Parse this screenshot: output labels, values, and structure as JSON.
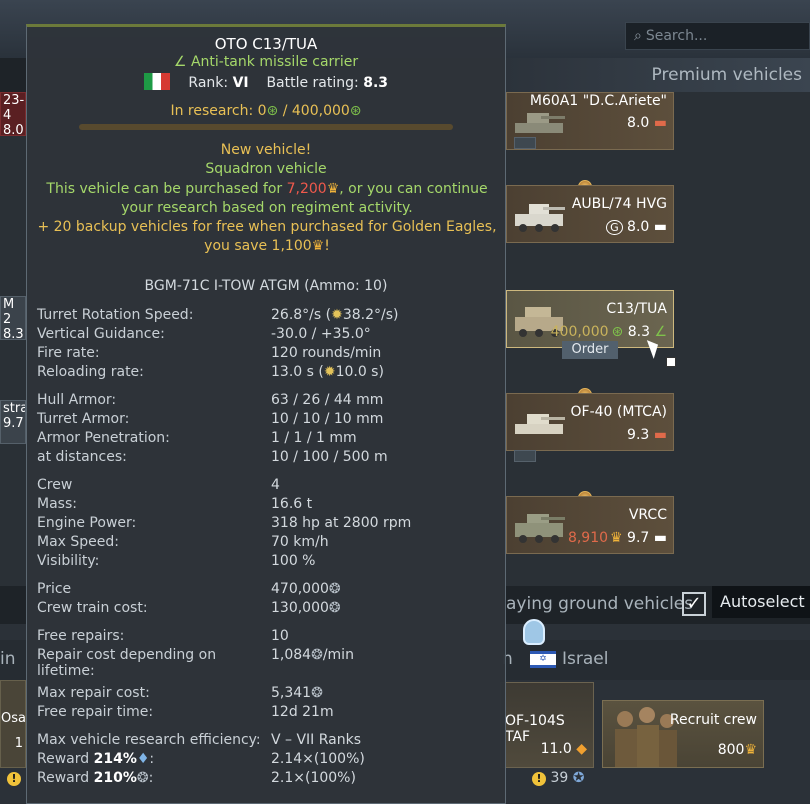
{
  "search": {
    "placeholder": "Search..."
  },
  "tree_header": "Premium vehicles",
  "left_cards": [
    {
      "text": "23-4",
      "sub": "8.0"
    },
    {
      "text": "M 2",
      "sub": "8.3"
    },
    {
      "text": "stra",
      "sub": "9.7"
    }
  ],
  "vehicles": [
    {
      "name": "M60A1 \"D.C.Ariete\"",
      "br": "8.0",
      "icon": "tank-icon"
    },
    {
      "name": "AUBL/74 HVG",
      "br": "8.0",
      "icon": "tank-icon",
      "prefix": "G"
    },
    {
      "name": "C13/TUA",
      "br": "8.3",
      "research": "400,000",
      "icon": "tank-icon"
    },
    {
      "name": "OF-40 (MTCA)",
      "br": "9.3",
      "icon": "tank-icon"
    },
    {
      "name": "VRCC",
      "br": "9.7",
      "price": "8,910",
      "icon": "tank-icon"
    }
  ],
  "order_label": "Order",
  "ground_label": "aying ground vehicles",
  "autoselect_label": "Autoselect",
  "nation_tabs": {
    "left": "in",
    "mid": "n",
    "israel": "Israel"
  },
  "crew_slot": {
    "name": "OF-104S TAF",
    "br": "11.0",
    "left_name": "Osa-",
    "left_br": "1"
  },
  "recruit": {
    "label": "Recruit crew",
    "price": "800"
  },
  "crew_count": "39",
  "tooltip": {
    "title": "OTO C13/TUA",
    "subtitle": "Anti-tank missile carrier",
    "rank_label": "Rank:",
    "rank_value": "VI",
    "br_label": "Battle rating:",
    "br_value": "8.3",
    "research_label": "In research: 0",
    "research_total": " / 400,000",
    "research_progress": 0,
    "new_vehicle": "New vehicle!",
    "squadron": "Squadron vehicle",
    "desc_a": "This vehicle can be purchased for ",
    "desc_price": "7,200",
    "desc_b": ", or you can continue your research based on regiment activity.",
    "backup_a": "+ 20 backup vehicles for free when purchased for Golden Eagles, you save 1,100",
    "backup_b": "!",
    "weapon": "BGM-71C I-TOW ATGM (Ammo: 10)",
    "stats": {
      "turret_rot": {
        "k": "Turret Rotation Speed:",
        "v": "26.8°/s (",
        "v2": "38.2°/s)"
      },
      "vertical": {
        "k": "Vertical Guidance:",
        "v": "-30.0 / +35.0°"
      },
      "fire_rate": {
        "k": "Fire rate:",
        "v": "120 rounds/min"
      },
      "reload": {
        "k": "Reloading rate:",
        "v": "13.0 s (",
        "v2": "10.0 s)"
      },
      "hull": {
        "k": "Hull Armor:",
        "v": "63 / 26 / 44 mm"
      },
      "turret": {
        "k": "Turret Armor:",
        "v": "10 / 10 / 10 mm"
      },
      "pen": {
        "k": "Armor Penetration:",
        "v": "1 / 1 / 1 mm"
      },
      "dist": {
        "k": "at distances:",
        "v": "10 / 100 / 500 m"
      },
      "crew": {
        "k": "Crew",
        "v": "4"
      },
      "mass": {
        "k": "Mass:",
        "v": "16.6 t"
      },
      "engine": {
        "k": "Engine Power:",
        "v": "318 hp at 2800 rpm"
      },
      "speed": {
        "k": "Max Speed:",
        "v": "70 km/h"
      },
      "vis": {
        "k": "Visibility:",
        "v": "100 %"
      },
      "price": {
        "k": "Price",
        "v": "470,000"
      },
      "train": {
        "k": "Crew train cost:",
        "v": "130,000"
      },
      "free_rep": {
        "k": "Free repairs:",
        "v": "10"
      },
      "rep_cost": {
        "k": "Repair cost depending on lifetime:",
        "v": "1,084",
        "v2": "/min"
      },
      "max_rep": {
        "k": "Max repair cost:",
        "v": "5,341"
      },
      "free_time": {
        "k": "Free repair time:",
        "v": "12d 21m"
      },
      "eff": {
        "k": "Max vehicle research efficiency:",
        "v": "V – VII Ranks"
      },
      "reward_rp": {
        "k": "Reward ",
        "pct": "214%",
        "v": "2.14×(100%)"
      },
      "reward_sl": {
        "k": "Reward ",
        "pct": "210%",
        "v": "2.1×(100%)"
      }
    }
  },
  "colors": {
    "accent_green": "#a5d86a",
    "accent_gold": "#e8c055",
    "price_red": "#f0594c"
  }
}
